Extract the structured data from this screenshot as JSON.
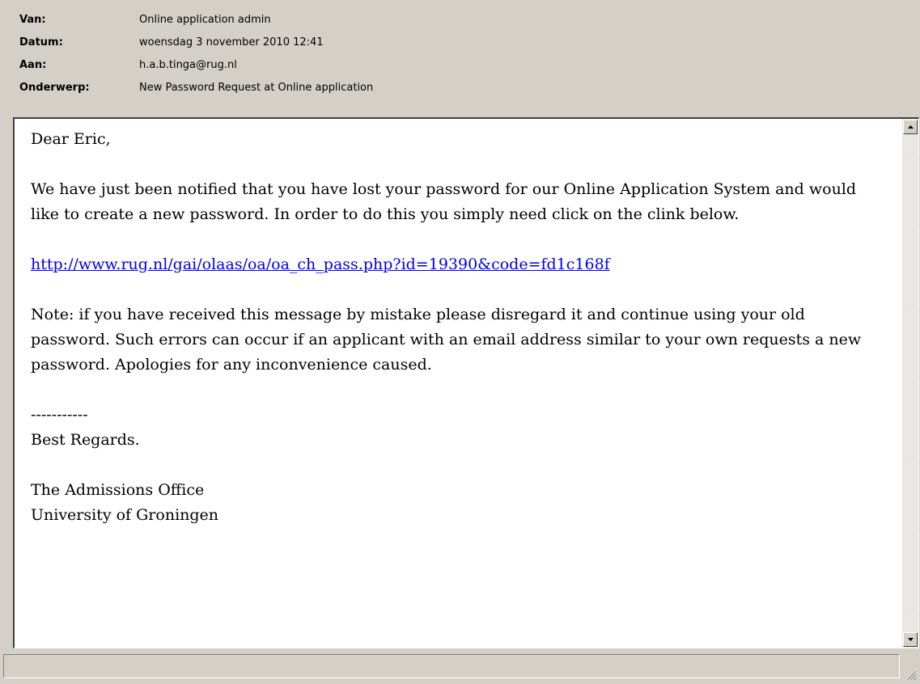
{
  "header": {
    "fields": [
      {
        "label": "Van:",
        "value": "Online application admin"
      },
      {
        "label": "Datum:",
        "value": "woensdag 3 november 2010 12:41"
      },
      {
        "label": "Aan:",
        "value": "h.a.b.tinga@rug.nl"
      },
      {
        "label": "Onderwerp:",
        "value": "New Password Request at Online application"
      }
    ]
  },
  "message": {
    "greeting": "Dear Eric,",
    "paragraph1": "We have just been notified that you have lost your password for our Online Application System and would like to create a new password. In order to do this you simply need click on the clink below.",
    "link": "http://www.rug.nl/gai/olaas/oa/oa_ch_pass.php?id=19390&code=fd1c168f",
    "paragraph2": "Note: if you have received this message by mistake please disregard it and continue using your old password. Such errors can occur if an applicant with an email address similar to your own requests a new password. Apologies for any inconvenience caused.",
    "separator": "-----------",
    "closing": "Best Regards.",
    "signature_line1": "The Admissions Office",
    "signature_line2": "University of Groningen"
  },
  "icons": {
    "scroll_up": "scroll-up-arrow-icon",
    "scroll_down": "scroll-down-arrow-icon",
    "resize_grip": "resize-grip-icon"
  },
  "status": {
    "text": ""
  }
}
